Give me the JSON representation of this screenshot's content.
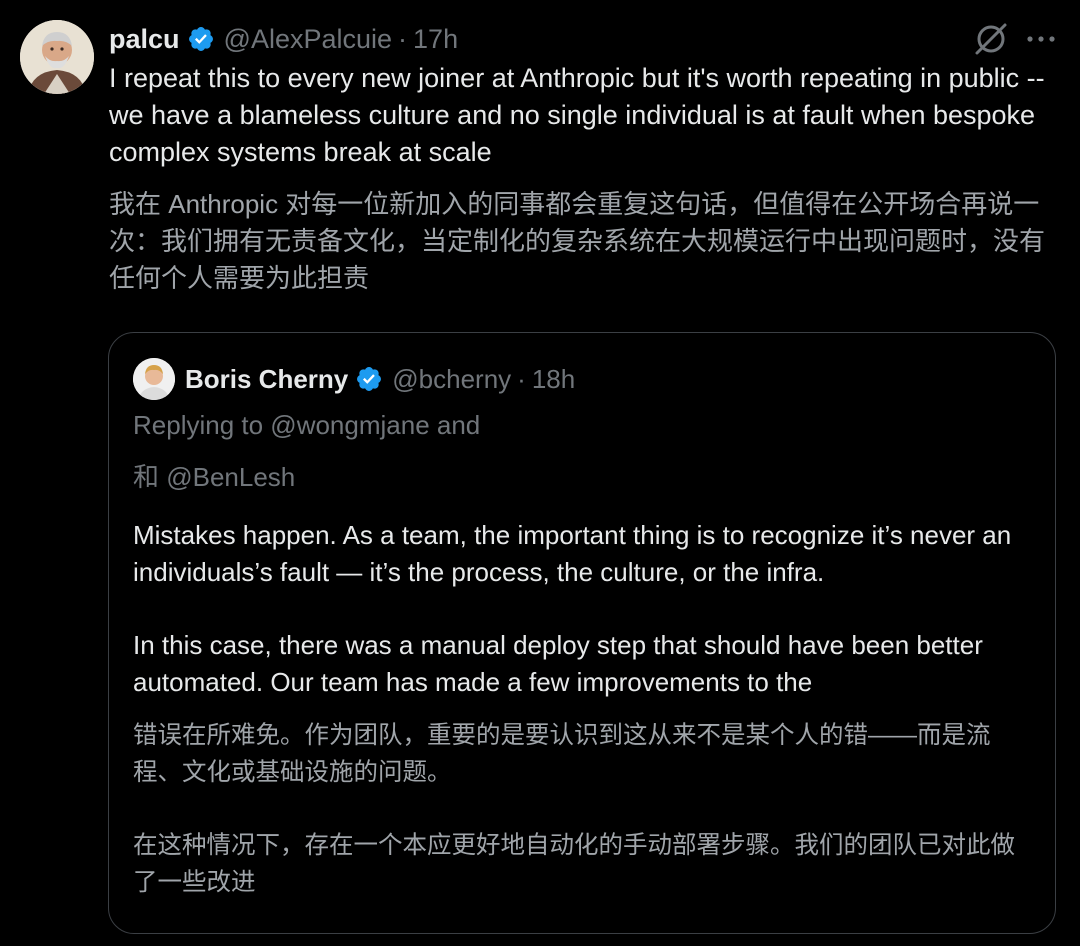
{
  "colors": {
    "background": "#000000",
    "text_primary": "#e7e9ea",
    "text_secondary": "#71767b",
    "translation_text": "#a0a5aa",
    "verified_blue": "#1d9bf0",
    "card_border": "#3b3f44"
  },
  "icons": {
    "verified": "verified-badge-icon",
    "grok": "grok-icon",
    "more": "more-options-icon"
  },
  "tweet": {
    "author_name": "palcu",
    "handle": "@AlexPalcuie",
    "separator": "·",
    "time": "17h",
    "text": "I repeat this to every new joiner at Anthropic but it's worth repeating in public -- we have a blameless culture and no single individual is at fault when bespoke complex systems break at scale",
    "translation": "我在 Anthropic 对每一位新加入的同事都会重复这句话，但值得在公开场合再说一次：我们拥有无责备文化，当定制化的复杂系统在大规模运行中出现问题时，没有任何个人需要为此担责"
  },
  "quote": {
    "author_name": "Boris Cherny",
    "handle": "@bcherny",
    "separator": "·",
    "time": "18h",
    "replying_to": "Replying to @wongmjane and",
    "replying_to_zh": "和 @BenLesh",
    "paragraph1": "Mistakes happen. As a team, the important thing is to recognize it’s never an individuals’s fault — it’s the process, the culture, or the infra.",
    "paragraph2": "In this case, there was a manual deploy step that should have been better automated. Our team has made a few improvements to the",
    "translation_paragraph1": "错误在所难免。作为团队，重要的是要认识到这从来不是某个人的错——而是流程、文化或基础设施的问题。",
    "translation_paragraph2": "在这种情况下，存在一个本应更好地自动化的手动部署步骤。我们的团队已对此做了一些改进"
  }
}
